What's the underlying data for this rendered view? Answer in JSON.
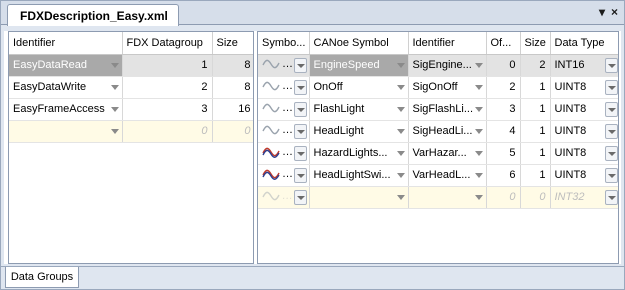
{
  "window": {
    "tab_title": "FDXDescription_Easy.xml",
    "dropdown_glyph": "▾",
    "close_glyph": "×"
  },
  "groups_table": {
    "columns": [
      "Identifier",
      "FDX Datagroup",
      "Size"
    ],
    "rows": [
      {
        "identifier": "EasyDataRead",
        "datagroup": "1",
        "size": "8"
      },
      {
        "identifier": "EasyDataWrite",
        "datagroup": "2",
        "size": "8"
      },
      {
        "identifier": "EasyFrameAccess",
        "datagroup": "3",
        "size": "16"
      }
    ],
    "new_row": {
      "datagroup": "0",
      "size": "0"
    }
  },
  "items_table": {
    "columns": [
      "Symbo...",
      "CANoe Symbol",
      "Identifier",
      "Of...",
      "Size",
      "Data Type"
    ],
    "rows": [
      {
        "symbol_icon": "signal-icon",
        "canoe_symbol": "EngineSpeed",
        "identifier": "SigEngine...",
        "offset": "0",
        "size": "2",
        "data_type": "INT16"
      },
      {
        "symbol_icon": "signal-icon",
        "canoe_symbol": "OnOff",
        "identifier": "SigOnOff",
        "offset": "2",
        "size": "1",
        "data_type": "UINT8"
      },
      {
        "symbol_icon": "signal-icon",
        "canoe_symbol": "FlashLight",
        "identifier": "SigFlashLi...",
        "offset": "3",
        "size": "1",
        "data_type": "UINT8"
      },
      {
        "symbol_icon": "signal-icon",
        "canoe_symbol": "HeadLight",
        "identifier": "SigHeadLi...",
        "offset": "4",
        "size": "1",
        "data_type": "UINT8"
      },
      {
        "symbol_icon": "variable-icon",
        "canoe_symbol": "HazardLights...",
        "identifier": "VarHazar...",
        "offset": "5",
        "size": "1",
        "data_type": "UINT8"
      },
      {
        "symbol_icon": "variable-icon",
        "canoe_symbol": "HeadLightSwi...",
        "identifier": "VarHeadL...",
        "offset": "6",
        "size": "1",
        "data_type": "UINT8"
      }
    ],
    "new_row": {
      "offset": "0",
      "size": "0",
      "data_type": "INT32"
    }
  },
  "bottom_tabs": [
    "Data Groups"
  ],
  "colors": {
    "signal_wave": "#9aa3ad",
    "variable_wave_red": "#c0392b",
    "variable_wave_blue": "#2c3e8f"
  }
}
